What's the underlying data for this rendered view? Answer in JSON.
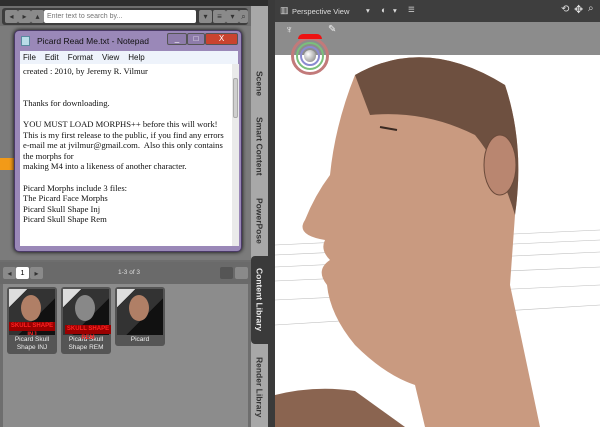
{
  "search": {
    "placeholder": "Enter text to search by..."
  },
  "notepad": {
    "title": "Picard Read Me.txt - Notepad",
    "menu": [
      "File",
      "Edit",
      "Format",
      "View",
      "Help"
    ],
    "text": "created : 2010, by Jeremy R. Vilmur\n\n\nThanks for downloading.\n\nYOU MUST LOAD MORPHS++ before this will work!\nThis is my first release to the public, if you find any errors e-mail me at jvilmur@gmail.com.  Also this only contains the morphs for\nmaking M4 into a likeness of another character.\n\nPicard Morphs include 3 files:\nThe Picard Face Morphs\nPicard Skull Shape Inj\nPicard Skull Shape Rem",
    "buttons": {
      "minimize": "_",
      "maximize": "□",
      "close": "X"
    }
  },
  "pager": {
    "page": "1",
    "count": "1-3 of 3"
  },
  "thumbnails": [
    {
      "label": "Picard Skull Shape INJ",
      "overlay": "SKULL SHAPE INJ"
    },
    {
      "label": "Picard Skull Shape REM",
      "overlay": "SKULL SHAPE REM"
    },
    {
      "label": "Picard",
      "overlay": ""
    }
  ],
  "tabs": [
    "Scene",
    "Smart Content",
    "PowerPose",
    "Content Library",
    "Render Library"
  ],
  "active_tab": "Content Library",
  "viewport": {
    "camera": "Perspective View"
  },
  "colors": {
    "accent": "#f29a18",
    "notepad_frame": "#9a88b8",
    "close": "#c9432f"
  }
}
